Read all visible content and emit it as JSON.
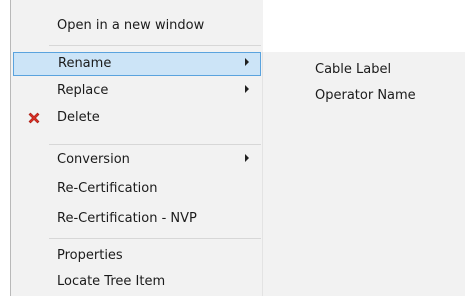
{
  "menu": {
    "items": [
      {
        "label": "Open in a new window"
      },
      {
        "label": "Rename"
      },
      {
        "label": "Replace"
      },
      {
        "label": "Delete",
        "icon": "delete-x-icon",
        "icon_color": "#d93025"
      },
      {
        "label": "Conversion"
      },
      {
        "label": "Re-Certification"
      },
      {
        "label": "Re-Certification - NVP"
      },
      {
        "label": "Properties"
      },
      {
        "label": "Locate Tree Item"
      }
    ],
    "selected_item": "Rename",
    "highlight_color": "#cce4f7",
    "highlight_border_color": "#5aa3de"
  },
  "submenu": {
    "items": [
      {
        "label": "Cable Label"
      },
      {
        "label": "Operator Name"
      }
    ]
  }
}
